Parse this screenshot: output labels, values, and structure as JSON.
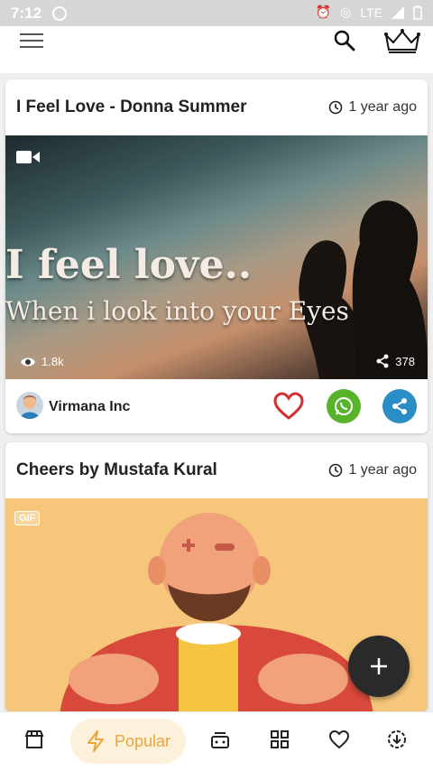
{
  "status_bar": {
    "time": "7:12",
    "network": "LTE"
  },
  "app_bar": {
    "menu_icon": "hamburger-icon",
    "search_icon": "search-icon",
    "premium_icon": "crown-icon"
  },
  "posts": [
    {
      "title": "I Feel Love - Donna Summer",
      "time_ago": "1 year ago",
      "media_type": "video",
      "overlay_line1": "I feel love..",
      "overlay_line2": "When i look into your Eyes",
      "views": "1.8k",
      "shares": "378",
      "author": "Virmana Inc"
    },
    {
      "title": "Cheers by Mustafa Kural",
      "time_ago": "1 year ago",
      "media_type": "gif",
      "badge": "GIF"
    }
  ],
  "bottom_nav": {
    "active_label": "Popular",
    "items": [
      "store-icon",
      "popular-icon",
      "fresh-icon",
      "categories-icon",
      "favorites-icon",
      "downloads-icon"
    ]
  },
  "colors": {
    "like": "#d32f2f",
    "whatsapp": "#58b32b",
    "share": "#2b8dc6",
    "popular_accent": "#e9a73b",
    "fab": "#2a2a2a"
  }
}
